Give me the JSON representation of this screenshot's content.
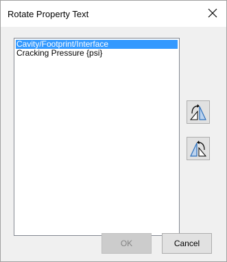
{
  "window": {
    "title": "Rotate Property Text",
    "close_glyph": "✕"
  },
  "list": {
    "items": [
      {
        "label": "Cavity/Footprint/Interface",
        "selected": true
      },
      {
        "label": "Cracking Pressure {psi}",
        "selected": false
      }
    ]
  },
  "tools": {
    "rotate_clockwise_icon": "rotate-clockwise-icon",
    "rotate_counterclockwise_icon": "rotate-counterclockwise-icon"
  },
  "buttons": {
    "ok_label": "OK",
    "ok_enabled": false,
    "cancel_label": "Cancel"
  },
  "colors": {
    "selection": "#3399ff",
    "icon_blue": "#2a6ebb"
  }
}
